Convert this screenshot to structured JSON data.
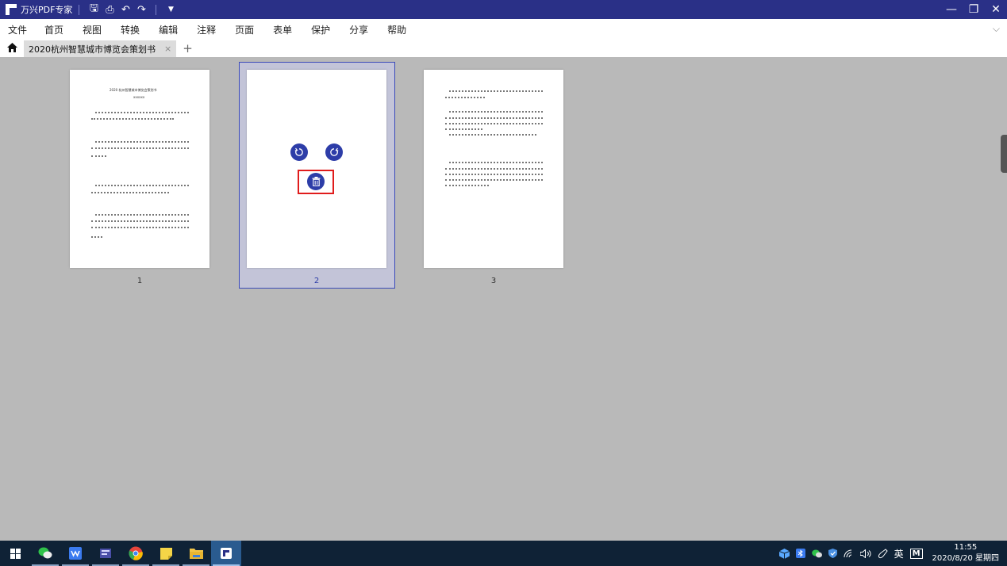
{
  "titlebar": {
    "app_title": "万兴PDF专家",
    "qa": {
      "save": "🖫",
      "print": "⎙",
      "undo": "↶",
      "redo": "↷",
      "more": "▼"
    },
    "win": {
      "min": "—",
      "restore": "❐",
      "close": "✕"
    }
  },
  "menu": [
    "文件",
    "首页",
    "视图",
    "转换",
    "编辑",
    "注释",
    "页面",
    "表单",
    "保护",
    "分享",
    "帮助"
  ],
  "menu_chevron": "⌵",
  "tab": {
    "title": "2020杭州智慧城市博览会策划书",
    "close": "×",
    "add": "+"
  },
  "pages": [
    {
      "num": "1"
    },
    {
      "num": "2"
    },
    {
      "num": "3"
    }
  ],
  "page1": {
    "title": "2020 杭州智慧城市博览会策划书",
    "subtitle": "xxxxxx"
  },
  "taskbar": {
    "tray_lang": "英",
    "tray_m": "M",
    "time": "11:55",
    "date": "2020/8/20 星期四"
  },
  "colors": {
    "titlebar": "#2a3087",
    "accent": "#2d3da8",
    "delete_highlight": "#e01c1c",
    "taskbar": "#0f2236"
  }
}
